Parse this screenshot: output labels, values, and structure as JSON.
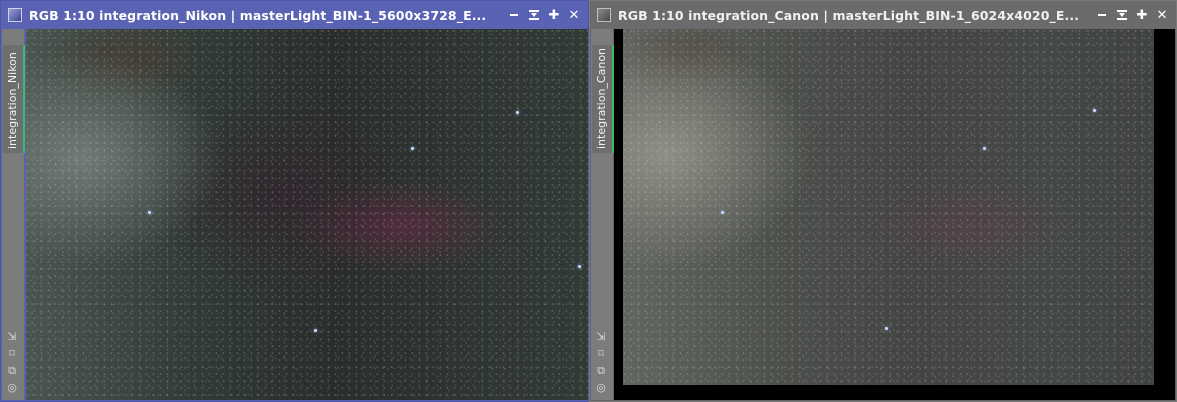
{
  "windows": [
    {
      "title": "RGB 1:10 integration_Nikon | masterLight_BIN-1_5600x3728_E...",
      "tab_label": "integration_Nikon",
      "active": true,
      "accent": "#5a62b4"
    },
    {
      "title": "RGB 1:10 integration_Canon | masterLight_BIN-1_6024x4020_E...",
      "tab_label": "integration_Canon",
      "active": false,
      "accent": "#6b6b6b"
    }
  ],
  "controls": [
    "minimize-icon",
    "shade-icon",
    "maximize-icon",
    "close-icon"
  ],
  "tool_icons": [
    "arrow-resize-icon",
    "fit-icon",
    "clone-icon",
    "target-icon"
  ],
  "tab_indicator_color": "#3bbd5b"
}
